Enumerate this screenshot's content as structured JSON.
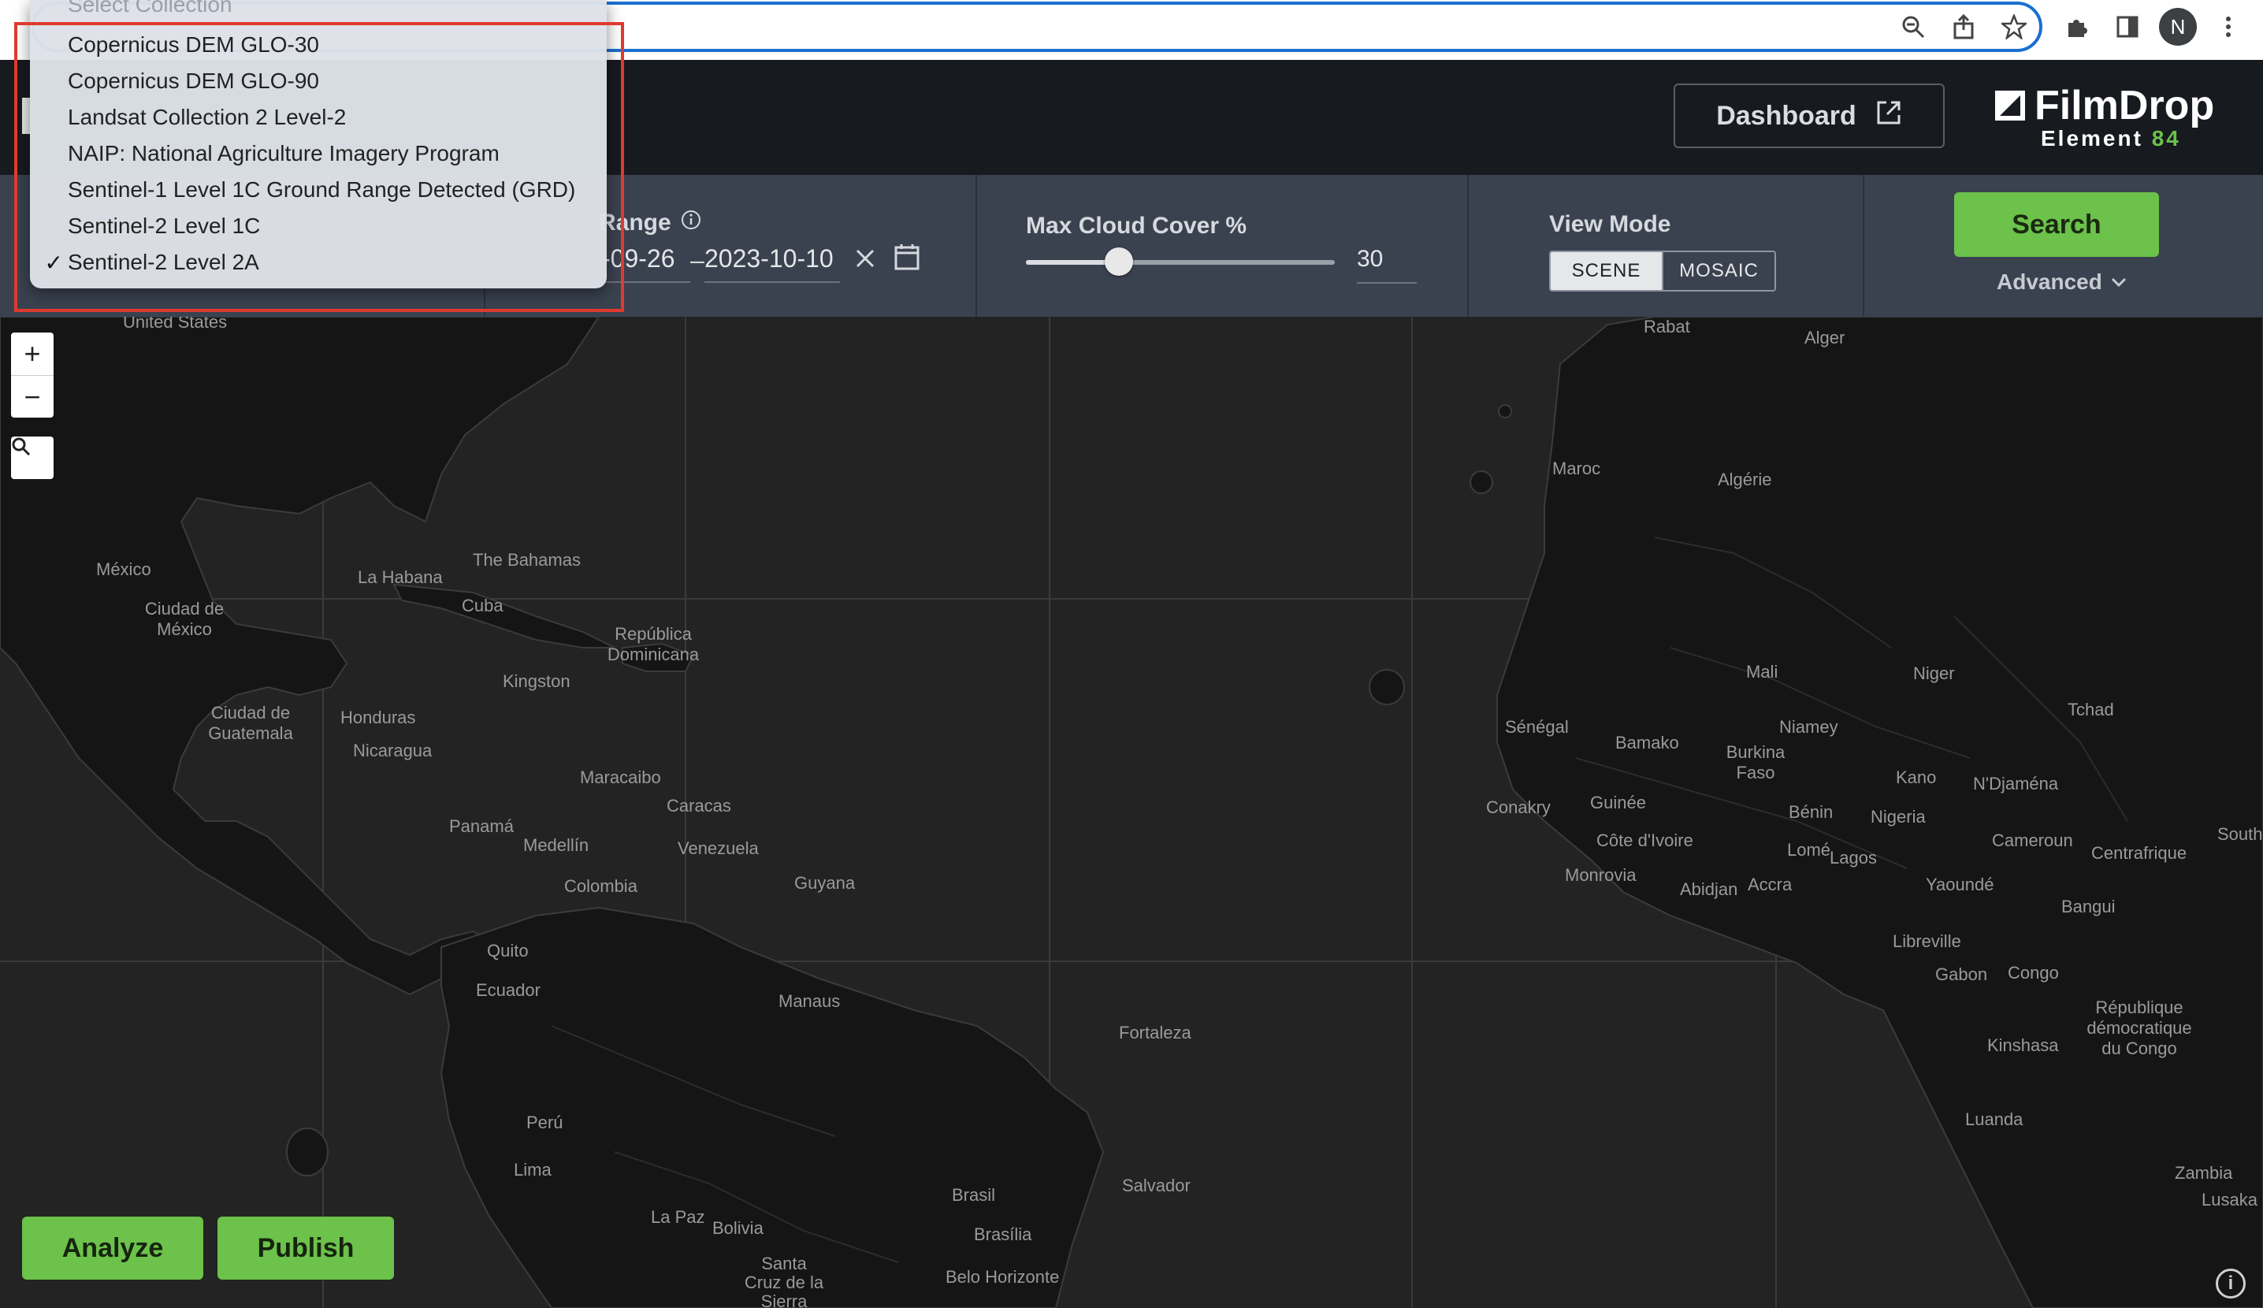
{
  "browser": {
    "icons": [
      "zoom-icon",
      "share-icon",
      "star-icon",
      "extensions-icon",
      "sidepanel-icon",
      "menu-icon"
    ],
    "avatar_letter": "N"
  },
  "header": {
    "dashboard_label": "Dashboard",
    "brand_name": "FilmDrop",
    "brand_sub": "Element",
    "brand_num": "84"
  },
  "filters": {
    "date_label": "Range",
    "date_start": "-09-26",
    "date_sep": "–",
    "date_end": "2023-10-10",
    "cloud_label": "Max Cloud Cover %",
    "cloud_value": "30",
    "cloud_fraction": 0.3,
    "viewmode_label": "View Mode",
    "viewmode_options": [
      "SCENE",
      "MOSAIC"
    ],
    "viewmode_selected": "SCENE",
    "search_label": "Search",
    "advanced_label": "Advanced"
  },
  "dropdown": {
    "placeholder": "Select Collection",
    "items": [
      {
        "label": "Copernicus DEM GLO-30",
        "check": ""
      },
      {
        "label": "Copernicus DEM GLO-90",
        "check": ""
      },
      {
        "label": "Landsat Collection 2 Level-2",
        "check": ""
      },
      {
        "label": "NAIP: National Agriculture Imagery Program",
        "check": ""
      },
      {
        "label": "Sentinel-1 Level 1C Ground Range Detected (GRD)",
        "check": ""
      },
      {
        "label": "Sentinel-2 Level 1C",
        "check": ""
      },
      {
        "label": "Sentinel-2 Level 2A",
        "check": "✓"
      }
    ]
  },
  "map": {
    "zoom_in": "+",
    "zoom_out": "−",
    "info": "i",
    "labels": [
      "United States",
      "México",
      "Ciudad de México",
      "La Habana",
      "The Bahamas",
      "Cuba",
      "República Dominicana",
      "Kingston",
      "Ciudad de Guatemala",
      "Honduras",
      "Nicaragua",
      "Panamá",
      "Maracaibo",
      "Caracas",
      "Venezuela",
      "Medellín",
      "Colombia",
      "Guyana",
      "Quito",
      "Ecuador",
      "Manaus",
      "Fortaleza",
      "Perú",
      "Lima",
      "La Paz",
      "Bolivia",
      "Brasil",
      "Brasília",
      "Salvador",
      "Santa Cruz de la Sierra",
      "Belo Horizonte",
      "Rabat",
      "Alger",
      "Maroc",
      "Algérie",
      "Mali",
      "Niger",
      "Tchad",
      "Sénégal",
      "Bamako",
      "Niamey",
      "Burkina Faso",
      "Conakry",
      "Guinée",
      "Côte d'Ivoire",
      "Bénin",
      "Nigeria",
      "Kano",
      "N'Djaména",
      "Cameroun",
      "Monrovia",
      "Abidjan",
      "Accra",
      "Lomé",
      "Lagos",
      "Yaoundé",
      "Libreville",
      "Gabon",
      "Congo",
      "Centrafrique",
      "Bangui",
      "République démocratique du Congo",
      "Kinshasa",
      "Luanda",
      "Zambia",
      "Lusaka",
      "South Su"
    ]
  },
  "actions": {
    "analyze_label": "Analyze",
    "publish_label": "Publish"
  }
}
